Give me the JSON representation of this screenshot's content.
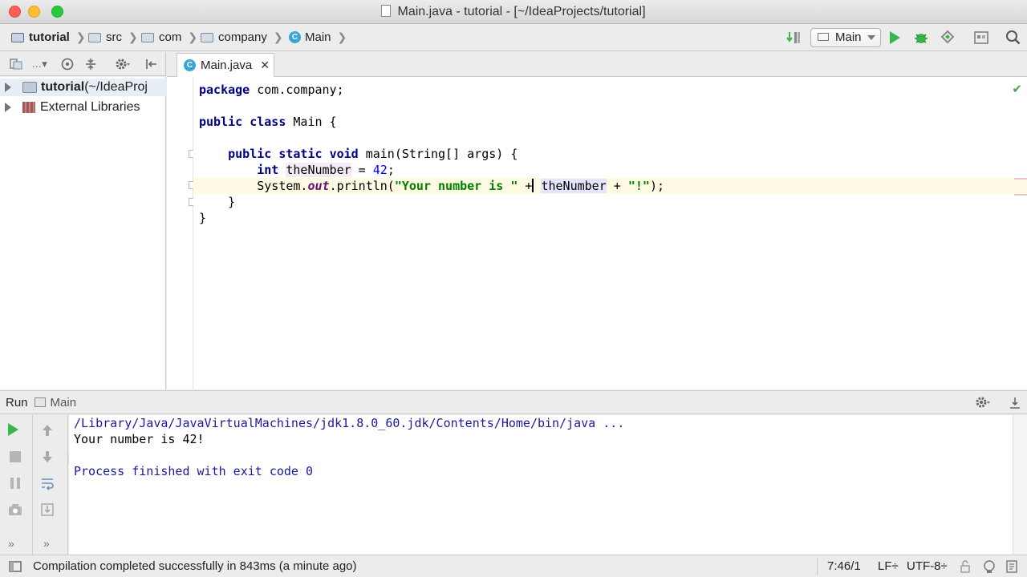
{
  "window": {
    "title": "Main.java - tutorial - [~/IdeaProjects/tutorial]"
  },
  "breadcrumbs": [
    {
      "label": "tutorial",
      "icon": "project-folder-icon"
    },
    {
      "label": "src",
      "icon": "folder-icon"
    },
    {
      "label": "com",
      "icon": "folder-icon"
    },
    {
      "label": "company",
      "icon": "folder-icon"
    },
    {
      "label": "Main",
      "icon": "class-icon"
    }
  ],
  "toolbar": {
    "run_config": "Main"
  },
  "project_tree": [
    {
      "label": "tutorial",
      "suffix": " (~/IdeaProj",
      "selected": true
    },
    {
      "label": "External Libraries",
      "suffix": "",
      "selected": false
    }
  ],
  "editor": {
    "tab_label": "Main.java",
    "class_icon_letter": "C",
    "lines": {
      "l1_kw": "package",
      "l1_rest": " com.company;",
      "l3_kw1": "public",
      "l3_kw2": "class",
      "l3_rest": " Main {",
      "l5_kw1": "public",
      "l5_kw2": "static",
      "l5_kw3": "void",
      "l5_rest": " main(String[] args) {",
      "l6_kw": "int",
      "l6_var": "theNumber",
      "l6_mid": " = ",
      "l6_num": "42",
      "l6_end": ";",
      "l7_a": "System.",
      "l7_field": "out",
      "l7_b": ".println(",
      "l7_str1": "\"Your number is \"",
      "l7_plus": " +",
      "l7_var": "theNumber",
      "l7_c": " + ",
      "l7_str2": "\"!\"",
      "l7_end": ");",
      "l8": "}",
      "l9": "}"
    }
  },
  "run_panel": {
    "label": "Run",
    "config": "Main",
    "console": [
      {
        "text": "/Library/Java/JavaVirtualMachines/jdk1.8.0_60.jdk/Contents/Home/bin/java ...",
        "color": "#1a1a9e"
      },
      {
        "text": "Your number is 42!",
        "color": "#000000"
      },
      {
        "text": "",
        "color": "#000000"
      },
      {
        "text": "Process finished with exit code 0",
        "color": "#1a1a9e"
      }
    ]
  },
  "status_bar": {
    "message": "Compilation completed successfully in 843ms (a minute ago)",
    "position": "7:46/1",
    "line_sep": "LF÷",
    "encoding": "UTF-8÷"
  },
  "colors": {
    "run_green": "#3bb44a",
    "keyword": "#000080",
    "string": "#008000"
  }
}
